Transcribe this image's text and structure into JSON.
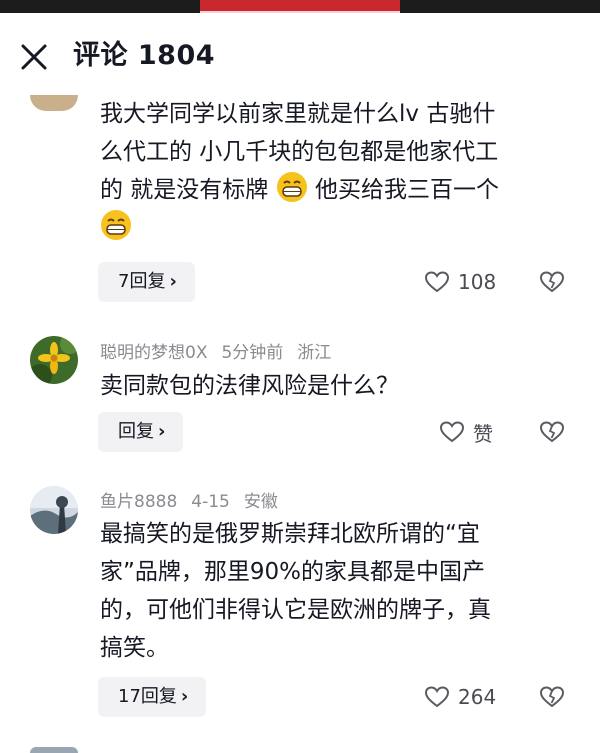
{
  "header": {
    "title": "评论 1804",
    "close_icon": "close-icon"
  },
  "comments": [
    {
      "text_line1": "我大学同学以前家里就是什么lv 古驰什",
      "text_line2": "么代工的 小几千块的包包都是他家代工",
      "text_line3a": "的 就是没有标牌",
      "text_line3b": "他买给我三百一个",
      "reply_label": "7回复",
      "like_count": "108"
    },
    {
      "username": "聪明的梦想0X",
      "time": "5分钟前",
      "location": "浙江",
      "text": "卖同款包的法律风险是什么？",
      "reply_label": "回复",
      "like_count": "赞"
    },
    {
      "username": "鱼片8888",
      "time": "4-15",
      "location": "安徽",
      "text_line1": "最搞笑的是俄罗斯崇拜北欧所谓的“宜",
      "text_line2": "家”品牌，那里90%的家具都是中国产",
      "text_line3": "的，可他们非得认它是欧洲的牌子，真",
      "text_line4": "搞笑。",
      "reply_label": "17回复",
      "like_count": "264"
    }
  ],
  "colors": {
    "meta": "#8a8b91",
    "reply_bg": "#f2f2f4",
    "text": "#161823"
  }
}
